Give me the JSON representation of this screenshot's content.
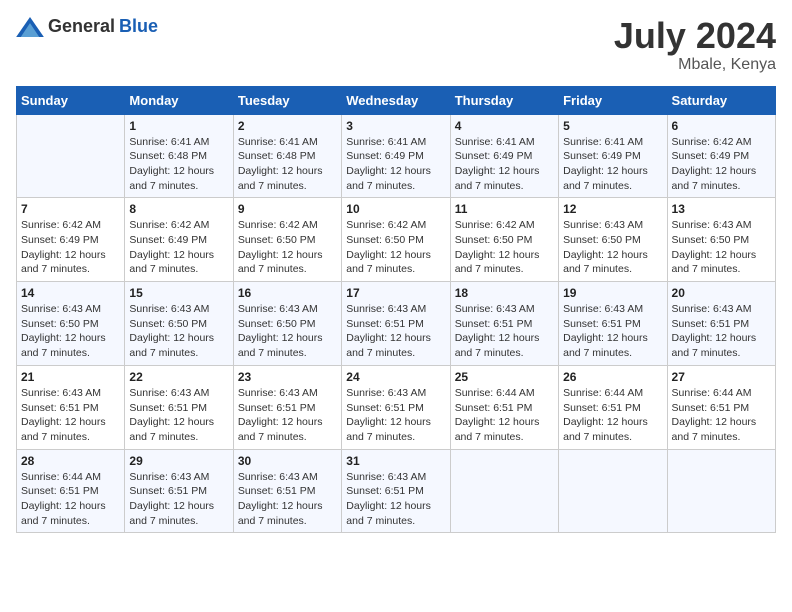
{
  "header": {
    "logo_general": "General",
    "logo_blue": "Blue",
    "month_year": "July 2024",
    "location": "Mbale, Kenya"
  },
  "days_of_week": [
    "Sunday",
    "Monday",
    "Tuesday",
    "Wednesday",
    "Thursday",
    "Friday",
    "Saturday"
  ],
  "weeks": [
    [
      {
        "day": "",
        "sunrise": "",
        "sunset": "",
        "daylight": ""
      },
      {
        "day": "1",
        "sunrise": "Sunrise: 6:41 AM",
        "sunset": "Sunset: 6:48 PM",
        "daylight": "Daylight: 12 hours and 7 minutes."
      },
      {
        "day": "2",
        "sunrise": "Sunrise: 6:41 AM",
        "sunset": "Sunset: 6:48 PM",
        "daylight": "Daylight: 12 hours and 7 minutes."
      },
      {
        "day": "3",
        "sunrise": "Sunrise: 6:41 AM",
        "sunset": "Sunset: 6:49 PM",
        "daylight": "Daylight: 12 hours and 7 minutes."
      },
      {
        "day": "4",
        "sunrise": "Sunrise: 6:41 AM",
        "sunset": "Sunset: 6:49 PM",
        "daylight": "Daylight: 12 hours and 7 minutes."
      },
      {
        "day": "5",
        "sunrise": "Sunrise: 6:41 AM",
        "sunset": "Sunset: 6:49 PM",
        "daylight": "Daylight: 12 hours and 7 minutes."
      },
      {
        "day": "6",
        "sunrise": "Sunrise: 6:42 AM",
        "sunset": "Sunset: 6:49 PM",
        "daylight": "Daylight: 12 hours and 7 minutes."
      }
    ],
    [
      {
        "day": "7",
        "sunrise": "Sunrise: 6:42 AM",
        "sunset": "Sunset: 6:49 PM",
        "daylight": "Daylight: 12 hours and 7 minutes."
      },
      {
        "day": "8",
        "sunrise": "Sunrise: 6:42 AM",
        "sunset": "Sunset: 6:49 PM",
        "daylight": "Daylight: 12 hours and 7 minutes."
      },
      {
        "day": "9",
        "sunrise": "Sunrise: 6:42 AM",
        "sunset": "Sunset: 6:50 PM",
        "daylight": "Daylight: 12 hours and 7 minutes."
      },
      {
        "day": "10",
        "sunrise": "Sunrise: 6:42 AM",
        "sunset": "Sunset: 6:50 PM",
        "daylight": "Daylight: 12 hours and 7 minutes."
      },
      {
        "day": "11",
        "sunrise": "Sunrise: 6:42 AM",
        "sunset": "Sunset: 6:50 PM",
        "daylight": "Daylight: 12 hours and 7 minutes."
      },
      {
        "day": "12",
        "sunrise": "Sunrise: 6:43 AM",
        "sunset": "Sunset: 6:50 PM",
        "daylight": "Daylight: 12 hours and 7 minutes."
      },
      {
        "day": "13",
        "sunrise": "Sunrise: 6:43 AM",
        "sunset": "Sunset: 6:50 PM",
        "daylight": "Daylight: 12 hours and 7 minutes."
      }
    ],
    [
      {
        "day": "14",
        "sunrise": "Sunrise: 6:43 AM",
        "sunset": "Sunset: 6:50 PM",
        "daylight": "Daylight: 12 hours and 7 minutes."
      },
      {
        "day": "15",
        "sunrise": "Sunrise: 6:43 AM",
        "sunset": "Sunset: 6:50 PM",
        "daylight": "Daylight: 12 hours and 7 minutes."
      },
      {
        "day": "16",
        "sunrise": "Sunrise: 6:43 AM",
        "sunset": "Sunset: 6:50 PM",
        "daylight": "Daylight: 12 hours and 7 minutes."
      },
      {
        "day": "17",
        "sunrise": "Sunrise: 6:43 AM",
        "sunset": "Sunset: 6:51 PM",
        "daylight": "Daylight: 12 hours and 7 minutes."
      },
      {
        "day": "18",
        "sunrise": "Sunrise: 6:43 AM",
        "sunset": "Sunset: 6:51 PM",
        "daylight": "Daylight: 12 hours and 7 minutes."
      },
      {
        "day": "19",
        "sunrise": "Sunrise: 6:43 AM",
        "sunset": "Sunset: 6:51 PM",
        "daylight": "Daylight: 12 hours and 7 minutes."
      },
      {
        "day": "20",
        "sunrise": "Sunrise: 6:43 AM",
        "sunset": "Sunset: 6:51 PM",
        "daylight": "Daylight: 12 hours and 7 minutes."
      }
    ],
    [
      {
        "day": "21",
        "sunrise": "Sunrise: 6:43 AM",
        "sunset": "Sunset: 6:51 PM",
        "daylight": "Daylight: 12 hours and 7 minutes."
      },
      {
        "day": "22",
        "sunrise": "Sunrise: 6:43 AM",
        "sunset": "Sunset: 6:51 PM",
        "daylight": "Daylight: 12 hours and 7 minutes."
      },
      {
        "day": "23",
        "sunrise": "Sunrise: 6:43 AM",
        "sunset": "Sunset: 6:51 PM",
        "daylight": "Daylight: 12 hours and 7 minutes."
      },
      {
        "day": "24",
        "sunrise": "Sunrise: 6:43 AM",
        "sunset": "Sunset: 6:51 PM",
        "daylight": "Daylight: 12 hours and 7 minutes."
      },
      {
        "day": "25",
        "sunrise": "Sunrise: 6:44 AM",
        "sunset": "Sunset: 6:51 PM",
        "daylight": "Daylight: 12 hours and 7 minutes."
      },
      {
        "day": "26",
        "sunrise": "Sunrise: 6:44 AM",
        "sunset": "Sunset: 6:51 PM",
        "daylight": "Daylight: 12 hours and 7 minutes."
      },
      {
        "day": "27",
        "sunrise": "Sunrise: 6:44 AM",
        "sunset": "Sunset: 6:51 PM",
        "daylight": "Daylight: 12 hours and 7 minutes."
      }
    ],
    [
      {
        "day": "28",
        "sunrise": "Sunrise: 6:44 AM",
        "sunset": "Sunset: 6:51 PM",
        "daylight": "Daylight: 12 hours and 7 minutes."
      },
      {
        "day": "29",
        "sunrise": "Sunrise: 6:43 AM",
        "sunset": "Sunset: 6:51 PM",
        "daylight": "Daylight: 12 hours and 7 minutes."
      },
      {
        "day": "30",
        "sunrise": "Sunrise: 6:43 AM",
        "sunset": "Sunset: 6:51 PM",
        "daylight": "Daylight: 12 hours and 7 minutes."
      },
      {
        "day": "31",
        "sunrise": "Sunrise: 6:43 AM",
        "sunset": "Sunset: 6:51 PM",
        "daylight": "Daylight: 12 hours and 7 minutes."
      },
      {
        "day": "",
        "sunrise": "",
        "sunset": "",
        "daylight": ""
      },
      {
        "day": "",
        "sunrise": "",
        "sunset": "",
        "daylight": ""
      },
      {
        "day": "",
        "sunrise": "",
        "sunset": "",
        "daylight": ""
      }
    ]
  ]
}
